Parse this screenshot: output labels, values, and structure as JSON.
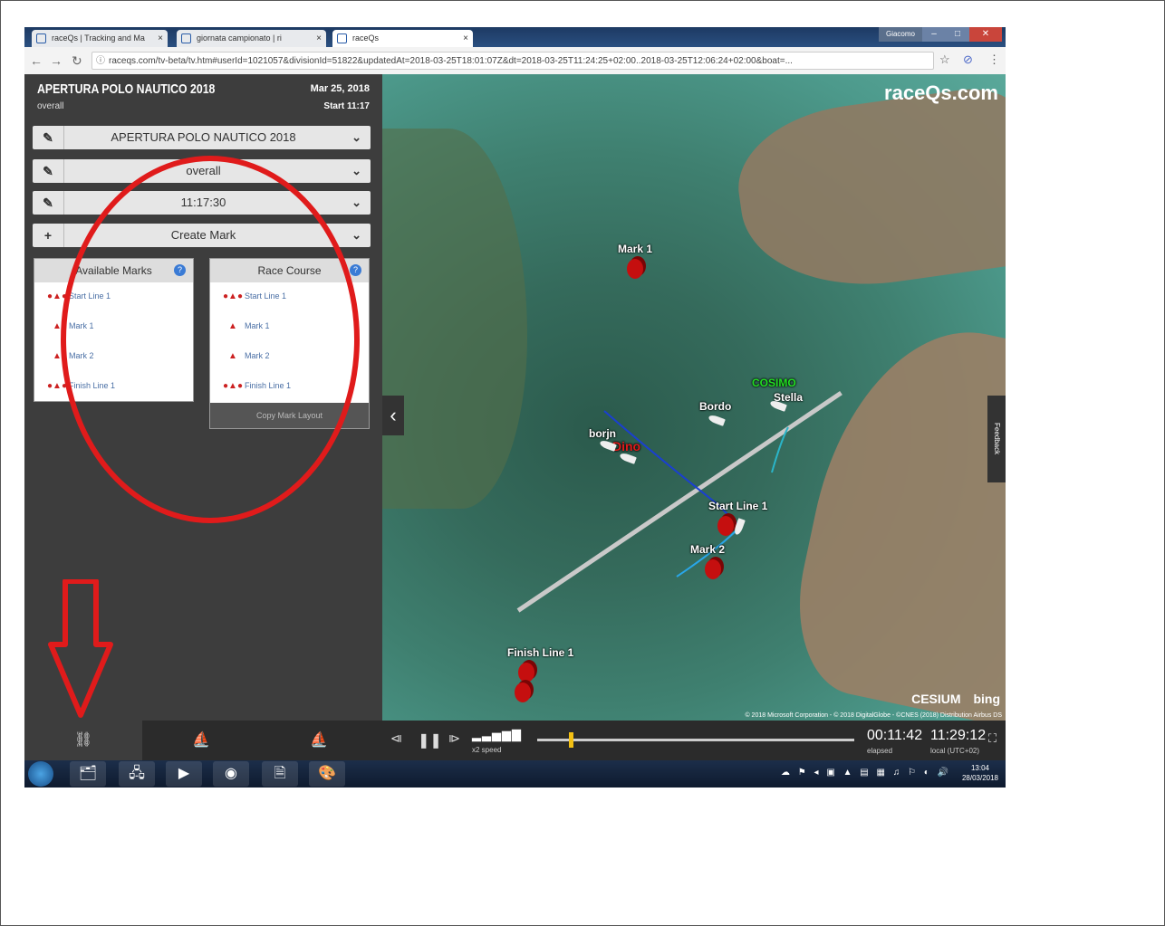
{
  "browser": {
    "tabs": [
      {
        "label": "raceQs | Tracking and Ma",
        "close": "×"
      },
      {
        "label": "giornata campionato | ri",
        "close": "×"
      },
      {
        "label": "raceQs",
        "close": "×"
      }
    ],
    "window_title": "Giacomo",
    "url": "raceqs.com/tv-beta/tv.htm#userId=1021057&divisionId=51822&updatedAt=2018-03-25T18:01:07Z&dt=2018-03-25T11:24:25+02:00..2018-03-25T12:06:24+02:00&boat=..."
  },
  "panel": {
    "title": "APERTURA POLO NAUTICO 2018",
    "subtitle": "overall",
    "date": "Mar 25, 2018",
    "start": "Start 11:17",
    "selectors": [
      {
        "icon": "edit-icon",
        "label": "APERTURA POLO NAUTICO 2018"
      },
      {
        "icon": "edit-icon",
        "label": "overall"
      },
      {
        "icon": "edit-icon",
        "label": "11:17:30"
      },
      {
        "icon": "plus-icon",
        "label": "Create Mark"
      }
    ],
    "available_marks": {
      "title": "Available Marks",
      "items": [
        "Start Line 1",
        "Mark 1",
        "Mark 2",
        "Finish Line 1"
      ]
    },
    "race_course": {
      "title": "Race Course",
      "items": [
        "Start Line 1",
        "Mark 1",
        "Mark 2",
        "Finish Line 1"
      ],
      "button": "Copy Mark Layout"
    }
  },
  "map": {
    "logo": "raceQs.com",
    "feedback": "Feedback",
    "labels": {
      "mark1": "Mark 1",
      "cosimo": "COSIMO",
      "stella": "Stella",
      "bordo": "Bordo",
      "borjn": "borjn",
      "dino": "Dino",
      "start_line": "Start Line 1",
      "mark2": "Mark 2",
      "finish_line": "Finish Line 1"
    },
    "cesium": "CESIUM",
    "bing": "bing",
    "credits": "© 2018 Microsoft Corporation - © 2018 DigitalGlobe - ©CNES (2018) Distribution Airbus DS"
  },
  "playback": {
    "speed": "x2 speed",
    "elapsed": "00:11:42",
    "elapsed_label": "elapsed",
    "local": "11:29:12",
    "local_label": "local (UTC+02)",
    "progress": 0.1
  },
  "taskbar": {
    "clock_time": "13:04",
    "clock_date": "28/03/2018"
  },
  "colors": {
    "annotation": "#e01b1b",
    "panel_bg": "#3d3d3d",
    "thumb": "#f3c013"
  }
}
